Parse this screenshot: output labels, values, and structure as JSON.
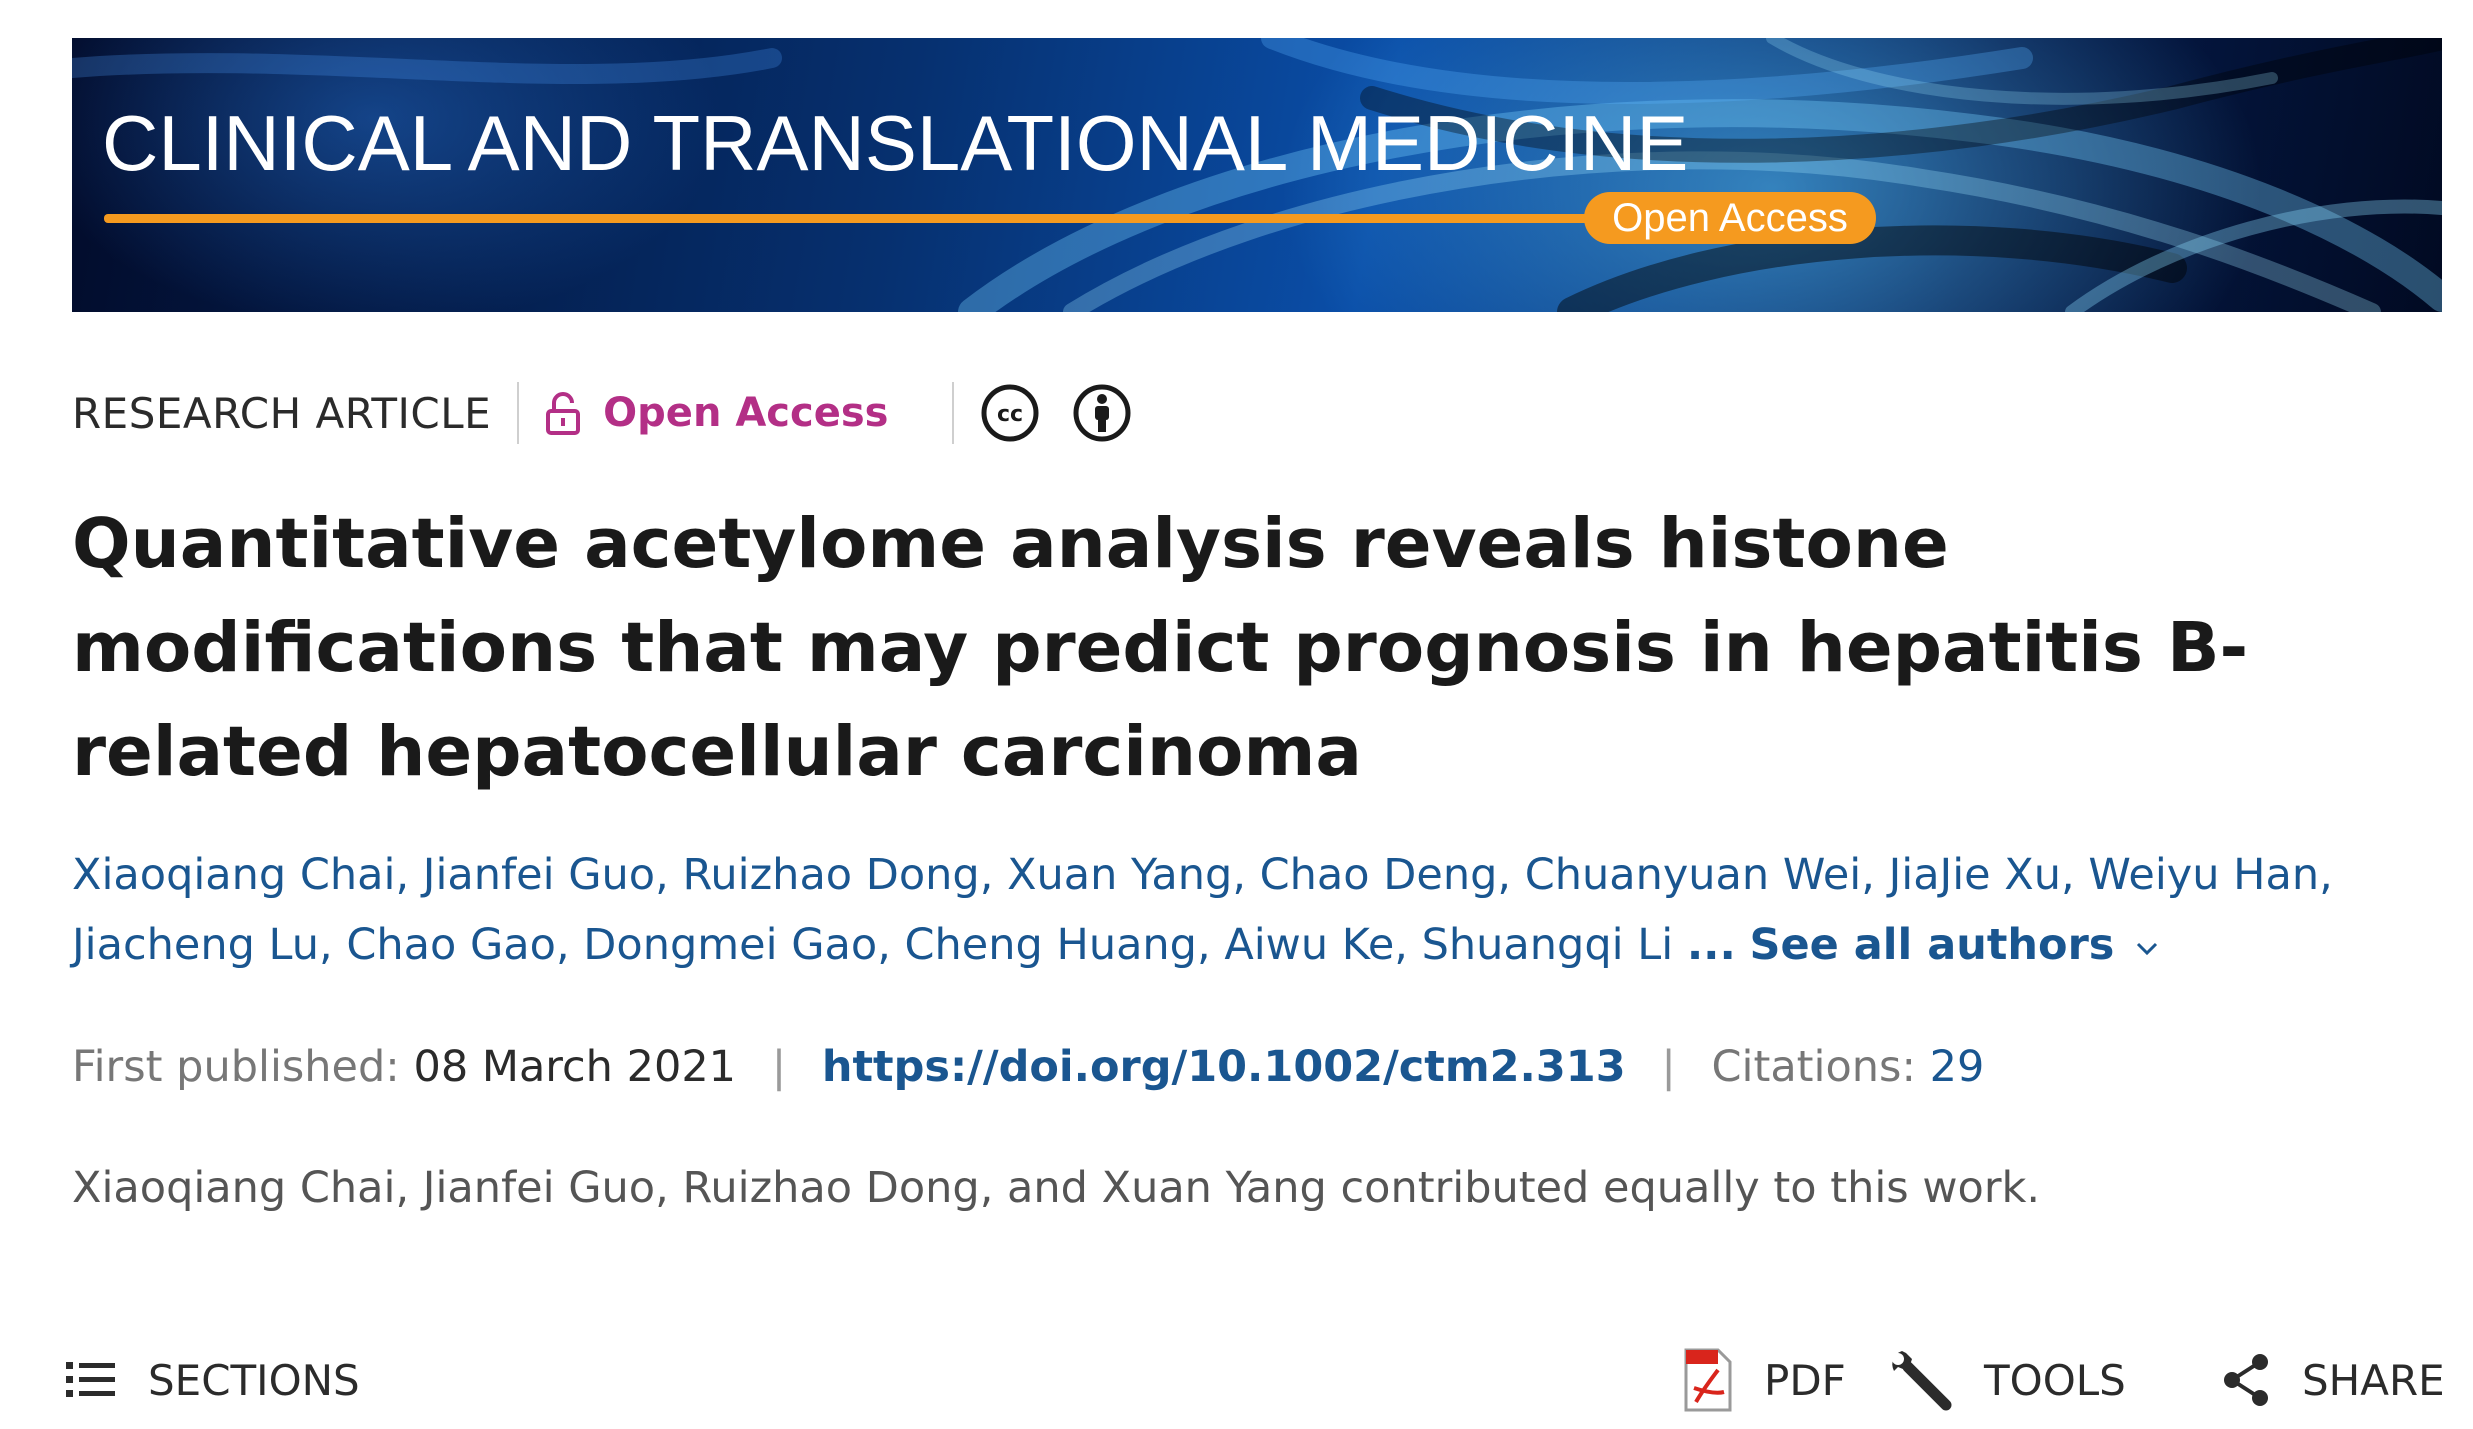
{
  "banner": {
    "journal_title": "CLINICAL AND TRANSLATIONAL MEDICINE",
    "open_access_label": "Open Access"
  },
  "meta": {
    "article_type": "RESEARCH ARTICLE",
    "open_access": "Open Access",
    "license_icons": [
      "creative-commons-icon",
      "attribution-icon"
    ]
  },
  "article": {
    "title": "Quantitative acetylome analysis reveals histone modifications that may predict prognosis in hepatitis B-related hepatocellular carcinoma"
  },
  "authors": {
    "list": [
      "Xiaoqiang Chai",
      "Jianfei Guo",
      "Ruizhao Dong",
      "Xuan Yang",
      "Chao Deng",
      "Chuanyuan Wei",
      "JiaJie Xu",
      "Weiyu Han",
      "Jiacheng Lu",
      "Chao Gao",
      "Dongmei Gao",
      "Cheng Huang",
      "Aiwu Ke",
      "Shuangqi Li"
    ],
    "ellipsis": "...",
    "see_all": "See all authors"
  },
  "publication": {
    "first_published_label": "First published:",
    "first_published_date": "08 March 2021",
    "separator": "|",
    "doi": "https://doi.org/10.1002/ctm2.313",
    "citations_label": "Citations:",
    "citations_count": "29"
  },
  "note": "Xiaoqiang Chai, Jianfei Guo, Ruizhao Dong, and Xuan Yang contributed equally to this work.",
  "toolbar": {
    "sections": "SECTIONS",
    "pdf": "PDF",
    "tools": "TOOLS",
    "share": "SHARE"
  },
  "colors": {
    "open_access_accent": "#b32f86",
    "link_blue": "#1a5690",
    "banner_orange": "#f59a1f",
    "banner_blue": "#0a4ea8"
  }
}
